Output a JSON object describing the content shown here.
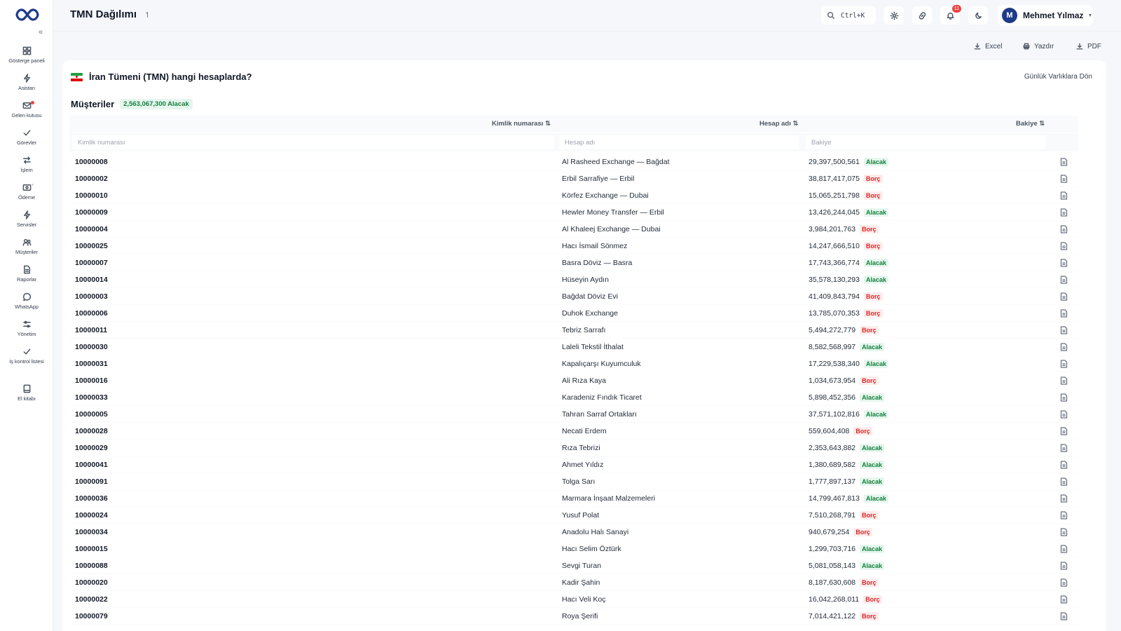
{
  "header": {
    "title": "TMN Dağılımı",
    "pin_glyph": "↿",
    "search_shortcut": "Ctrl+K",
    "notification_count": "11",
    "user": {
      "initial": "M",
      "name": "Mehmet Yılmaz"
    }
  },
  "sidebar": {
    "items": [
      {
        "label": "Gösterge paneli",
        "icon": "grid-icon"
      },
      {
        "label": "Asistan",
        "icon": "bolt-icon"
      },
      {
        "label": "Gelen kutusu",
        "icon": "mail-icon"
      },
      {
        "label": "Görevler",
        "icon": "check-icon"
      },
      {
        "label": "İşlem",
        "icon": "swap-icon"
      },
      {
        "label": "Ödeme",
        "icon": "payment-icon"
      },
      {
        "label": "Servisler",
        "icon": "bolt-icon"
      },
      {
        "label": "Müşteriler",
        "icon": "users-icon"
      },
      {
        "label": "Raporlar",
        "icon": "report-icon"
      },
      {
        "label": "WhatsApp",
        "icon": "chat-icon"
      },
      {
        "label": "Yönetim",
        "icon": "sliders-icon"
      },
      {
        "label": "İş kontrol listesi",
        "icon": "check-icon"
      },
      {
        "label": "El kitabı",
        "icon": "book-icon"
      }
    ]
  },
  "toolbar": {
    "excel": "Excel",
    "print": "Yazdır",
    "pdf": "PDF"
  },
  "card": {
    "question": "İran Tümeni (TMN) hangi hesaplarda?",
    "back_link": "Günlük Varlıklara Dön",
    "section_title": "Müşteriler",
    "section_total": "2,563,067,300 Alacak"
  },
  "table": {
    "columns": {
      "id": "Kimlik numarası ⇅",
      "name": "Hesap adı ⇅",
      "balance": "Bakiye ⇅"
    },
    "filters": {
      "id": "Kimlik numarası",
      "name": "Hesap adı",
      "balance": "Bakiye"
    },
    "status_colors": {
      "Alacak": "#15803d",
      "Borç": "#dc2626"
    },
    "rows": [
      {
        "id": "10000008",
        "name": "Al Rasheed Exchange — Bağdat",
        "balance": "29,397,500,561",
        "status": "Alacak"
      },
      {
        "id": "10000002",
        "name": "Erbil Sarrafiye — Erbil",
        "balance": "38,817,417,075",
        "status": "Borç"
      },
      {
        "id": "10000010",
        "name": "Körfez Exchange — Dubai",
        "balance": "15,065,251,798",
        "status": "Borç"
      },
      {
        "id": "10000009",
        "name": "Hewler Money Transfer — Erbil",
        "balance": "13,426,244,045",
        "status": "Alacak"
      },
      {
        "id": "10000004",
        "name": "Al Khaleej Exchange — Dubai",
        "balance": "3,984,201,763",
        "status": "Borç"
      },
      {
        "id": "10000025",
        "name": "Hacı İsmail Sönmez",
        "balance": "14,247,666,510",
        "status": "Borç"
      },
      {
        "id": "10000007",
        "name": "Basra Döviz — Basra",
        "balance": "17,743,366,774",
        "status": "Alacak"
      },
      {
        "id": "10000014",
        "name": "Hüseyin Aydın",
        "balance": "35,578,130,293",
        "status": "Alacak"
      },
      {
        "id": "10000003",
        "name": "Bağdat Döviz Evi",
        "balance": "41,409,843,794",
        "status": "Borç"
      },
      {
        "id": "10000006",
        "name": "Duhok Exchange",
        "balance": "13,785,070,353",
        "status": "Borç"
      },
      {
        "id": "10000011",
        "name": "Tebriz Sarrafı",
        "balance": "5,494,272,779",
        "status": "Borç"
      },
      {
        "id": "10000030",
        "name": "Laleli Tekstil İthalat",
        "balance": "8,582,568,997",
        "status": "Alacak"
      },
      {
        "id": "10000031",
        "name": "Kapalıçarşı Kuyumculuk",
        "balance": "17,229,538,340",
        "status": "Alacak"
      },
      {
        "id": "10000016",
        "name": "Ali Rıza Kaya",
        "balance": "1,034,673,954",
        "status": "Borç"
      },
      {
        "id": "10000033",
        "name": "Karadeniz Fındık Ticaret",
        "balance": "5,898,452,356",
        "status": "Alacak"
      },
      {
        "id": "10000005",
        "name": "Tahran Sarraf Ortakları",
        "balance": "37,571,102,816",
        "status": "Alacak"
      },
      {
        "id": "10000028",
        "name": "Necati Erdem",
        "balance": "559,604,408",
        "status": "Borç"
      },
      {
        "id": "10000029",
        "name": "Rıza Tebrizi",
        "balance": "2,353,643,882",
        "status": "Alacak"
      },
      {
        "id": "10000041",
        "name": "Ahmet Yıldız",
        "balance": "1,380,689,582",
        "status": "Alacak"
      },
      {
        "id": "10000091",
        "name": "Tolga Sarı",
        "balance": "1,777,897,137",
        "status": "Alacak"
      },
      {
        "id": "10000036",
        "name": "Marmara İnşaat Malzemeleri",
        "balance": "14,799,467,813",
        "status": "Alacak"
      },
      {
        "id": "10000024",
        "name": "Yusuf Polat",
        "balance": "7,510,268,791",
        "status": "Borç"
      },
      {
        "id": "10000034",
        "name": "Anadolu Halı Sanayi",
        "balance": "940,679,254",
        "status": "Borç"
      },
      {
        "id": "10000015",
        "name": "Hacı Selim Öztürk",
        "balance": "1,299,703,716",
        "status": "Alacak"
      },
      {
        "id": "10000088",
        "name": "Sevgi Turan",
        "balance": "5,081,058,143",
        "status": "Alacak"
      },
      {
        "id": "10000020",
        "name": "Kadir Şahin",
        "balance": "8,187,630,608",
        "status": "Borç"
      },
      {
        "id": "10000022",
        "name": "Hacı Veli Koç",
        "balance": "16,042,268,011",
        "status": "Borç"
      },
      {
        "id": "10000079",
        "name": "Roya Şerifi",
        "balance": "7,014,421,122",
        "status": "Borç"
      }
    ]
  }
}
